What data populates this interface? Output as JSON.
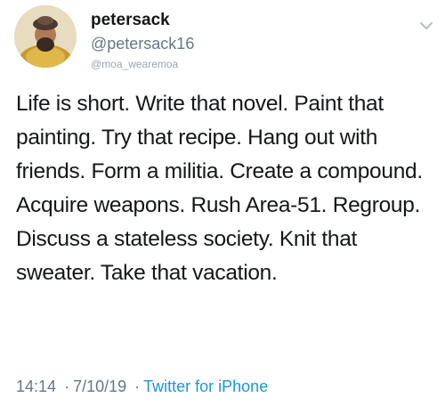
{
  "tweet": {
    "display_name": "petersack",
    "handle": "@petersack16",
    "source_tag": "@moa_wearemoa",
    "text": "Life is short. Write that novel. Paint that painting. Try that recipe. Hang out with friends. Form a militia. Create a compound. Acquire weapons. Rush Area-51. Regroup. Discuss a stateless society. Knit that sweater. Take that vacation.",
    "time": "14:14",
    "separator": "·",
    "date": "7/10/19",
    "client": "Twitter for iPhone"
  },
  "icons": {
    "avatar": "avatar-image",
    "menu": "chevron-down-icon"
  },
  "colors": {
    "name": "#14171a",
    "secondary": "#657786",
    "link": "#1b95e0"
  }
}
